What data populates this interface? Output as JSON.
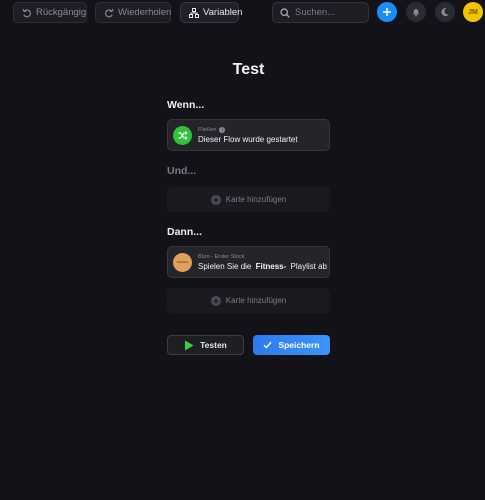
{
  "toolbar": {
    "undo_label": "Rückgängig",
    "redo_label": "Wiederholen",
    "variables_label": "Variablen",
    "search_placeholder": "Suchen..."
  },
  "user": {
    "initials": "JM"
  },
  "colors": {
    "accent": "#1c8cf7",
    "trigger_icon": "#2fc23a",
    "action_icon": "#e0a05a",
    "avatar": "#f2c400",
    "save_button": "#3187f5"
  },
  "flow": {
    "title": "Test",
    "when": {
      "label": "Wenn...",
      "card": {
        "source": "Fließen",
        "text": "Dieser Flow wurde gestartet",
        "icon": "shuffle-icon"
      }
    },
    "and": {
      "label": "Und...",
      "add_card_label": "Karte hinzufügen"
    },
    "then": {
      "label": "Dann...",
      "card": {
        "source": "Büro - Erster Stock",
        "text_pre": "Spielen Sie die",
        "text_bold": "Fitness-",
        "text_post": "Playlist ab",
        "icon": "speaker-icon",
        "icon_caption": "SONOS"
      },
      "add_card_label": "Karte hinzufügen"
    }
  },
  "actions": {
    "test_label": "Testen",
    "save_label": "Speichern"
  }
}
